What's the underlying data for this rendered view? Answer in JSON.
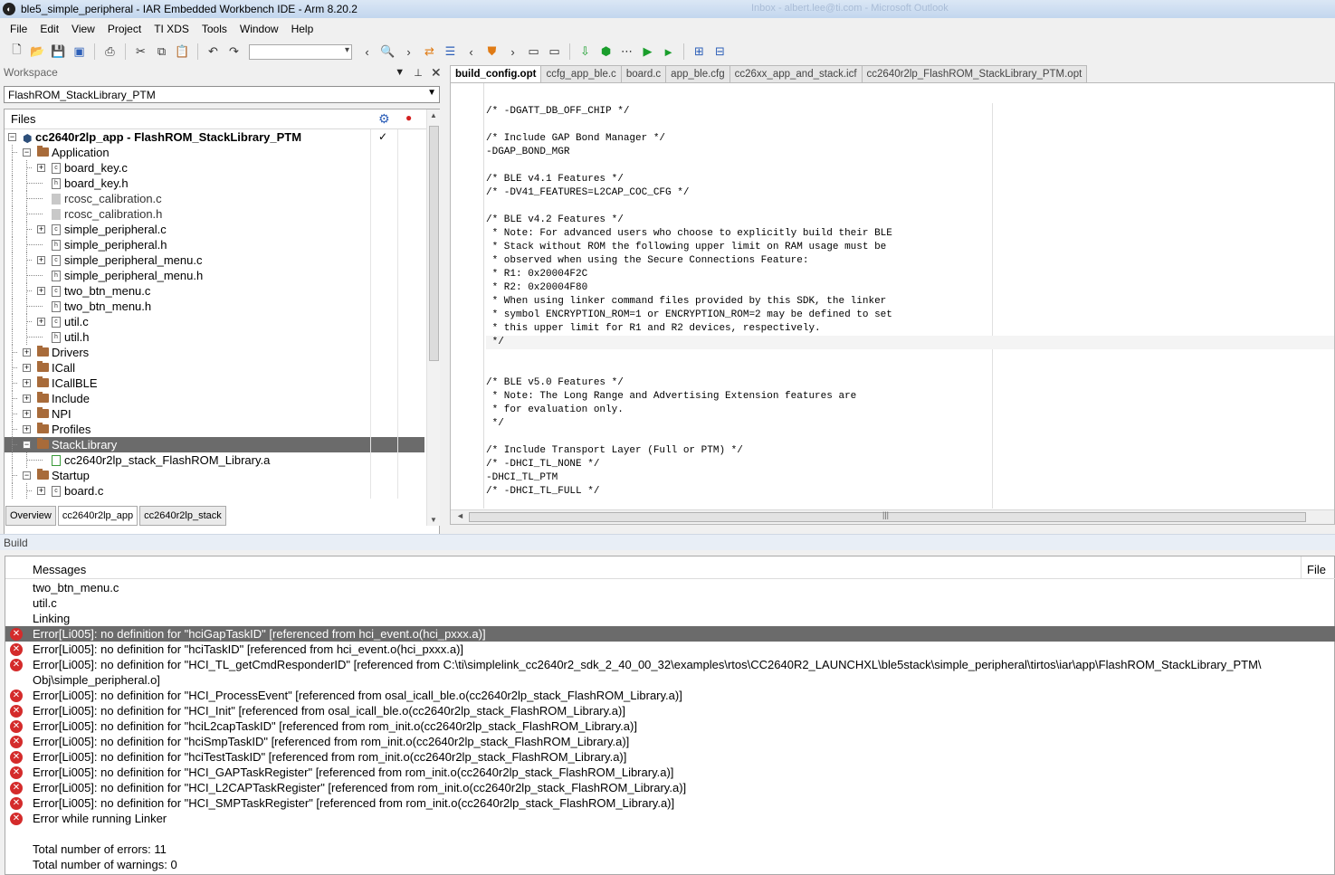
{
  "window": {
    "title": "ble5_simple_peripheral - IAR Embedded Workbench IDE - Arm 8.20.2",
    "ghost_text": "Inbox - albert.lee@ti.com - Microsoft Outlook"
  },
  "menu": [
    "File",
    "Edit",
    "View",
    "Project",
    "TI XDS",
    "Tools",
    "Window",
    "Help"
  ],
  "toolbar": {
    "icons": [
      "new-file-icon",
      "open-icon",
      "save-icon",
      "save-all-icon",
      "print-icon",
      "cut-icon",
      "copy-icon",
      "paste-icon",
      "undo-icon",
      "redo-icon",
      "find-combo",
      "nav-back-icon",
      "find-icon",
      "nav-forward-icon",
      "toggle-bookmark-icon",
      "prev-bookmark-icon",
      "shield-icon",
      "next-bookmark-icon",
      "prev-doc-icon",
      "next-doc-icon",
      "download-icon",
      "compile-icon",
      "make-icon",
      "debug-icon",
      "debug-no-download-icon",
      "stop-build-icon",
      "settings-icon"
    ]
  },
  "workspace": {
    "title": "Workspace",
    "configuration": "FlashROM_StackLibrary_PTM",
    "files_label": "Files",
    "tree": [
      {
        "label": "cc2640r2lp_app - FlashROM_StackLibrary_PTM",
        "type": "project",
        "level": 0,
        "expand": "minus",
        "bold": true,
        "check": "✓"
      },
      {
        "label": "Application",
        "type": "folder",
        "level": 1,
        "expand": "minus"
      },
      {
        "label": "board_key.c",
        "type": "c",
        "level": 2,
        "expand": "plus"
      },
      {
        "label": "board_key.h",
        "type": "h",
        "level": 2,
        "expand": ""
      },
      {
        "label": "rcosc_calibration.c",
        "type": "grey",
        "level": 2,
        "expand": ""
      },
      {
        "label": "rcosc_calibration.h",
        "type": "grey",
        "level": 2,
        "expand": ""
      },
      {
        "label": "simple_peripheral.c",
        "type": "c",
        "level": 2,
        "expand": "plus"
      },
      {
        "label": "simple_peripheral.h",
        "type": "h",
        "level": 2,
        "expand": ""
      },
      {
        "label": "simple_peripheral_menu.c",
        "type": "c",
        "level": 2,
        "expand": "plus"
      },
      {
        "label": "simple_peripheral_menu.h",
        "type": "h",
        "level": 2,
        "expand": ""
      },
      {
        "label": "two_btn_menu.c",
        "type": "c",
        "level": 2,
        "expand": "plus"
      },
      {
        "label": "two_btn_menu.h",
        "type": "h",
        "level": 2,
        "expand": ""
      },
      {
        "label": "util.c",
        "type": "c",
        "level": 2,
        "expand": "plus"
      },
      {
        "label": "util.h",
        "type": "h",
        "level": 2,
        "expand": ""
      },
      {
        "label": "Drivers",
        "type": "folder",
        "level": 1,
        "expand": "plus"
      },
      {
        "label": "ICall",
        "type": "folder",
        "level": 1,
        "expand": "plus"
      },
      {
        "label": "ICallBLE",
        "type": "folder",
        "level": 1,
        "expand": "plus"
      },
      {
        "label": "Include",
        "type": "folder",
        "level": 1,
        "expand": "plus"
      },
      {
        "label": "NPI",
        "type": "folder",
        "level": 1,
        "expand": "plus"
      },
      {
        "label": "Profiles",
        "type": "folder",
        "level": 1,
        "expand": "plus"
      },
      {
        "label": "StackLibrary",
        "type": "folder",
        "level": 1,
        "expand": "minus",
        "selected": true
      },
      {
        "label": "cc2640r2lp_stack_FlashROM_Library.a",
        "type": "lib",
        "level": 2,
        "expand": ""
      },
      {
        "label": "Startup",
        "type": "folder",
        "level": 1,
        "expand": "minus"
      },
      {
        "label": "board.c",
        "type": "c",
        "level": 2,
        "expand": "plus"
      }
    ],
    "tabs": [
      "Overview",
      "cc2640r2lp_app",
      "cc2640r2lp_stack"
    ],
    "active_tab": 1
  },
  "editor": {
    "tabs": [
      "build_config.opt",
      "ccfg_app_ble.c",
      "board.c",
      "app_ble.cfg",
      "cc26xx_app_and_stack.icf",
      "cc2640r2lp_FlashROM_StackLibrary_PTM.opt"
    ],
    "active_tab": 0,
    "lines": [
      "/* -DGATT_DB_OFF_CHIP */",
      "",
      "/* Include GAP Bond Manager */",
      "-DGAP_BOND_MGR",
      "",
      "/* BLE v4.1 Features */",
      "/* -DV41_FEATURES=L2CAP_COC_CFG */",
      "",
      "/* BLE v4.2 Features */",
      " * Note: For advanced users who choose to explicitly build their BLE",
      " * Stack without ROM the following upper limit on RAM usage must be",
      " * observed when using the Secure Connections Feature:",
      " * R1: 0x20004F2C",
      " * R2: 0x20004F80",
      " * When using linker command files provided by this SDK, the linker",
      " * symbol ENCRYPTION_ROM=1 or ENCRYPTION_ROM=2 may be defined to set",
      " * this upper limit for R1 and R2 devices, respectively.",
      " */",
      "",
      "",
      "/* BLE v5.0 Features */",
      " * Note: The Long Range and Advertising Extension features are",
      " * for evaluation only.",
      " */",
      "",
      "/* Include Transport Layer (Full or PTM) */",
      "/* -DHCI_TL_NONE */",
      "-DHCI_TL_PTM",
      "/* -DHCI_TL_FULL */"
    ],
    "highlight_line": 17
  },
  "build": {
    "title": "Build",
    "col_messages": "Messages",
    "col_file": "File",
    "messages": [
      {
        "text": "two_btn_menu.c",
        "error": false
      },
      {
        "text": "util.c",
        "error": false
      },
      {
        "text": "Linking",
        "error": false
      },
      {
        "text": "Error[Li005]: no definition for \"hciGapTaskID\" [referenced from hci_event.o(hci_pxxx.a)]",
        "error": true,
        "selected": true
      },
      {
        "text": "Error[Li005]: no definition for \"hciTaskID\" [referenced from hci_event.o(hci_pxxx.a)]",
        "error": true
      },
      {
        "text": "Error[Li005]: no definition for \"HCI_TL_getCmdResponderID\" [referenced from C:\\ti\\simplelink_cc2640r2_sdk_2_40_00_32\\examples\\rtos\\CC2640R2_LAUNCHXL\\ble5stack\\simple_peripheral\\tirtos\\iar\\app\\FlashROM_StackLibrary_PTM\\",
        "error": true
      },
      {
        "text": "Obj\\simple_peripheral.o]",
        "error": false
      },
      {
        "text": "Error[Li005]: no definition for \"HCI_ProcessEvent\" [referenced from osal_icall_ble.o(cc2640r2lp_stack_FlashROM_Library.a)]",
        "error": true
      },
      {
        "text": "Error[Li005]: no definition for \"HCI_Init\" [referenced from osal_icall_ble.o(cc2640r2lp_stack_FlashROM_Library.a)]",
        "error": true
      },
      {
        "text": "Error[Li005]: no definition for \"hciL2capTaskID\" [referenced from rom_init.o(cc2640r2lp_stack_FlashROM_Library.a)]",
        "error": true
      },
      {
        "text": "Error[Li005]: no definition for \"hciSmpTaskID\" [referenced from rom_init.o(cc2640r2lp_stack_FlashROM_Library.a)]",
        "error": true
      },
      {
        "text": "Error[Li005]: no definition for \"hciTestTaskID\" [referenced from rom_init.o(cc2640r2lp_stack_FlashROM_Library.a)]",
        "error": true
      },
      {
        "text": "Error[Li005]: no definition for \"HCI_GAPTaskRegister\" [referenced from rom_init.o(cc2640r2lp_stack_FlashROM_Library.a)]",
        "error": true
      },
      {
        "text": "Error[Li005]: no definition for \"HCI_L2CAPTaskRegister\" [referenced from rom_init.o(cc2640r2lp_stack_FlashROM_Library.a)]",
        "error": true
      },
      {
        "text": "Error[Li005]: no definition for \"HCI_SMPTaskRegister\" [referenced from rom_init.o(cc2640r2lp_stack_FlashROM_Library.a)]",
        "error": true
      },
      {
        "text": "Error while running Linker",
        "error": true
      },
      {
        "text": "",
        "error": false
      },
      {
        "text": "Total number of errors: 11",
        "error": false
      },
      {
        "text": "Total number of warnings: 0",
        "error": false
      }
    ]
  }
}
